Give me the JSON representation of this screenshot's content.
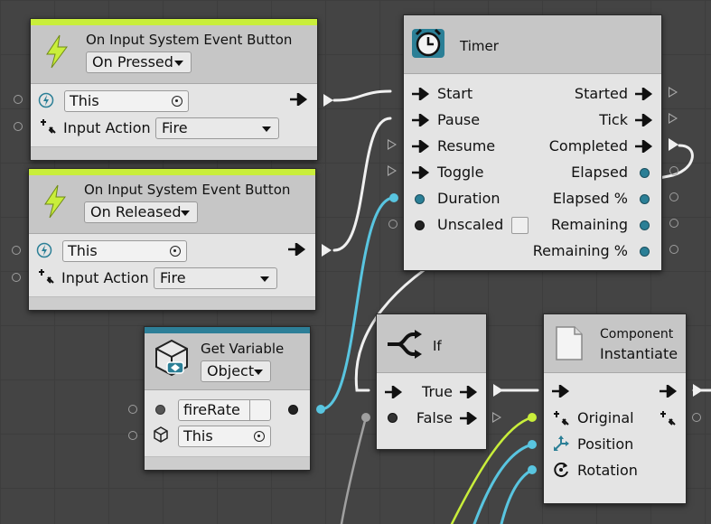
{
  "nodes": {
    "btn_pressed": {
      "title": "On Input System Event Button",
      "mode": "On Pressed",
      "target": "This",
      "action_label": "Input Action",
      "action": "Fire"
    },
    "btn_released": {
      "title": "On Input System Event Button",
      "mode": "On Released",
      "target": "This",
      "action_label": "Input Action",
      "action": "Fire"
    },
    "timer": {
      "title": "Timer",
      "inputs": [
        "Start",
        "Pause",
        "Resume",
        "Toggle",
        "Duration",
        "Unscaled"
      ],
      "outputs": [
        "Started",
        "Tick",
        "Completed",
        "Elapsed",
        "Elapsed %",
        "Remaining",
        "Remaining %"
      ]
    },
    "get_variable": {
      "title": "Get Variable",
      "kind": "Object",
      "name": "fireRate",
      "target": "This"
    },
    "if_node": {
      "title": "If",
      "true_label": "True",
      "false_label": "False"
    },
    "instantiate": {
      "subtitle": "Component",
      "title": "Instantiate",
      "inputs": [
        "Original",
        "Position",
        "Rotation"
      ]
    }
  },
  "colors": {
    "event_accent": "#c9ee3b",
    "variable_accent": "#2d7f98",
    "float_wire": "#59c5e0",
    "object_wire": "#c9ee3b",
    "control_wire": "#f0f0f0"
  }
}
